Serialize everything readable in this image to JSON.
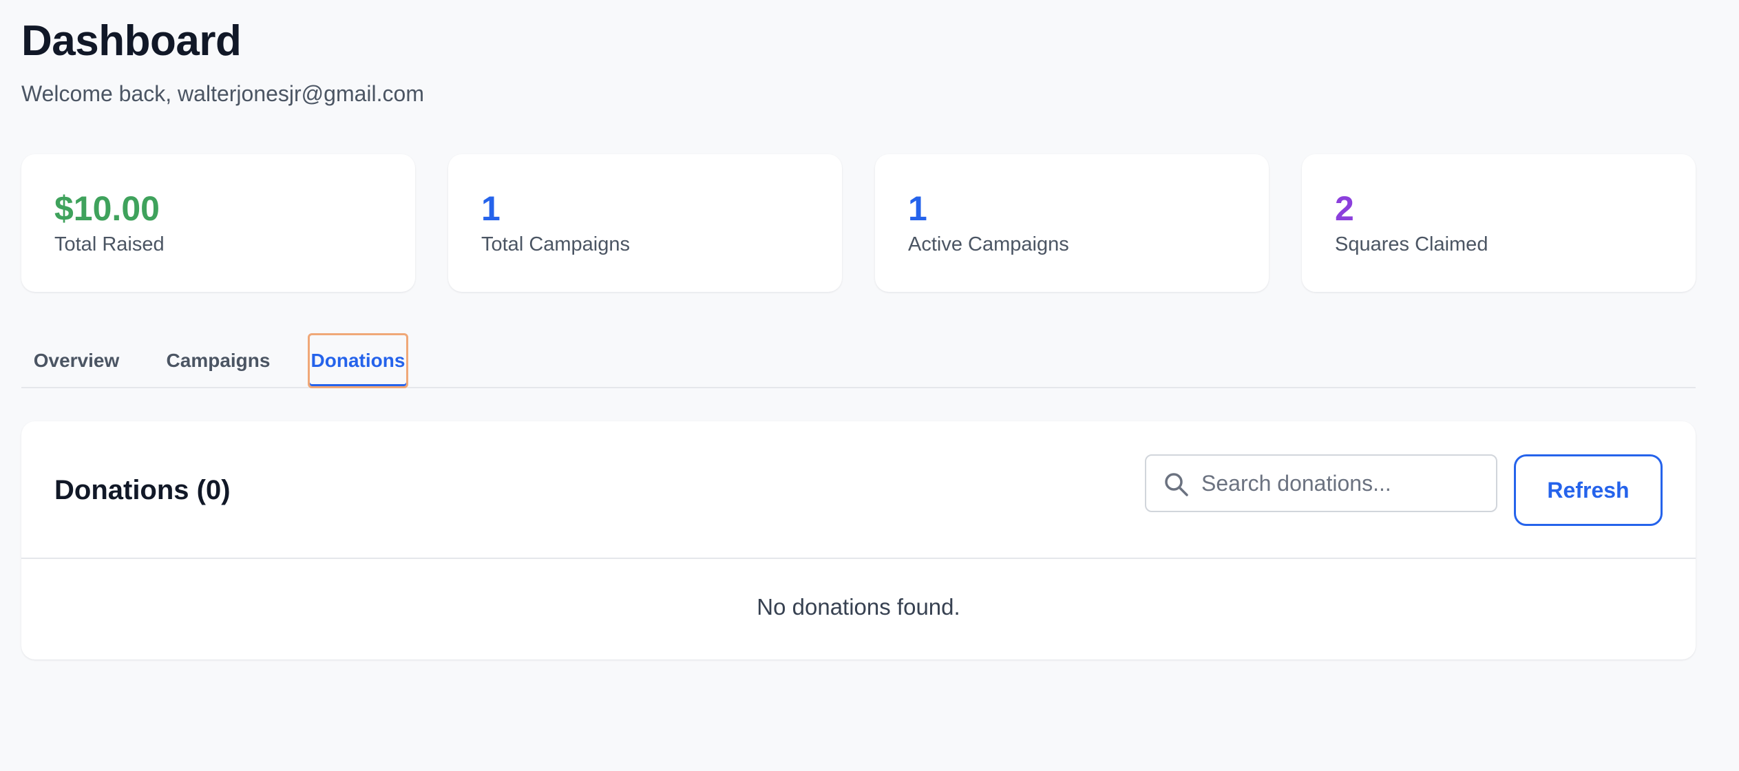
{
  "header": {
    "title": "Dashboard",
    "welcome": "Welcome back, walterjonesjr@gmail.com"
  },
  "stats": [
    {
      "value": "$10.00",
      "label": "Total Raised",
      "color": "#3fa25c"
    },
    {
      "value": "1",
      "label": "Total Campaigns",
      "color": "#2563eb"
    },
    {
      "value": "1",
      "label": "Active Campaigns",
      "color": "#2563eb"
    },
    {
      "value": "2",
      "label": "Squares Claimed",
      "color": "#8b3fdc"
    }
  ],
  "tabs": [
    {
      "label": "Overview",
      "active": false
    },
    {
      "label": "Campaigns",
      "active": false
    },
    {
      "label": "Donations",
      "active": true
    }
  ],
  "donations": {
    "title": "Donations (0)",
    "search_placeholder": "Search donations...",
    "search_value": "",
    "refresh_label": "Refresh",
    "empty_message": "No donations found.",
    "search_icon": "search-icon"
  },
  "colors": {
    "accent": "#2563eb",
    "focus_ring": "#f0a878"
  }
}
